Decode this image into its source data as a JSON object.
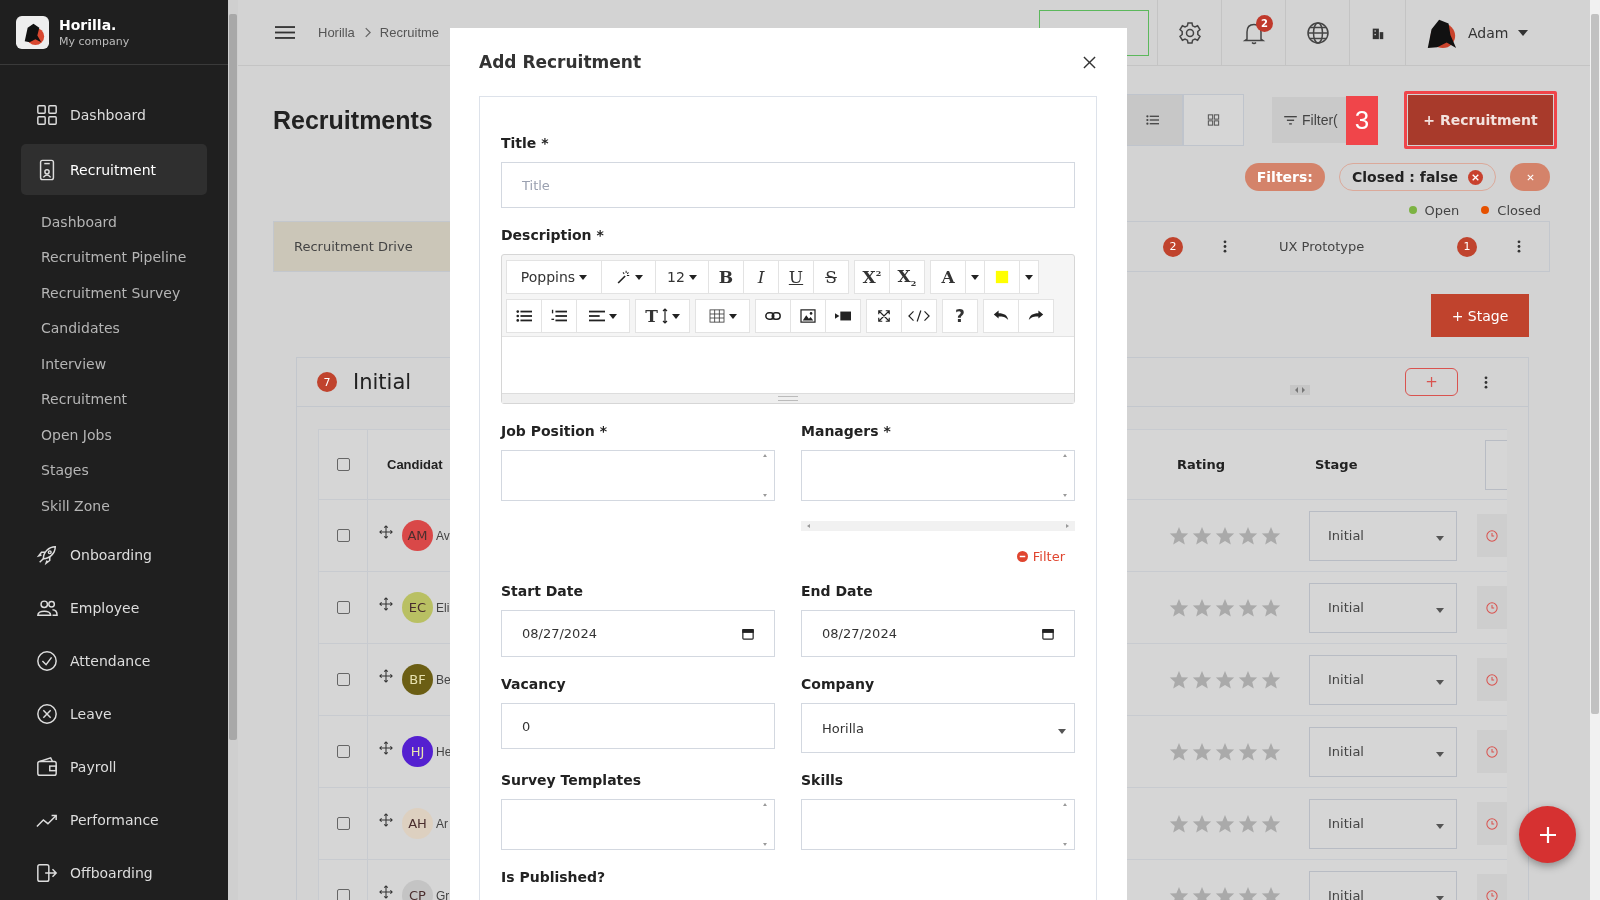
{
  "sidebar": {
    "brand": "Horilla.",
    "company": "My company",
    "items": [
      {
        "label": "Dashboard",
        "selected": false
      },
      {
        "label": "Recruitment",
        "selected": true,
        "children": [
          {
            "label": "Dashboard",
            "selected": false
          },
          {
            "label": "Recruitment Pipeline",
            "selected": false
          },
          {
            "label": "Recruitment Survey",
            "selected": false
          },
          {
            "label": "Candidates",
            "selected": false
          },
          {
            "label": "Interview",
            "selected": false
          },
          {
            "label": "Recruitment",
            "selected": false
          },
          {
            "label": "Open Jobs",
            "selected": false
          },
          {
            "label": "Stages",
            "selected": false
          },
          {
            "label": "Skill Zone",
            "selected": false
          }
        ]
      },
      {
        "label": "Onboarding",
        "selected": false
      },
      {
        "label": "Employee",
        "selected": false
      },
      {
        "label": "Attendance",
        "selected": false
      },
      {
        "label": "Leave",
        "selected": false
      },
      {
        "label": "Payroll",
        "selected": false
      },
      {
        "label": "Performance",
        "selected": false
      },
      {
        "label": "Offboarding",
        "selected": false
      }
    ]
  },
  "header": {
    "breadcrumb": [
      "Horilla",
      "Recruitme"
    ],
    "notifications": "2",
    "user": "Adam"
  },
  "page": {
    "title": "Recruitments",
    "views": [
      {
        "kind": "list",
        "selected": true
      },
      {
        "kind": "grid",
        "selected": false
      }
    ],
    "filter_button": "Filter(",
    "step_marker": "3",
    "add_button": "+ Recruitment",
    "filters_label": "Filters:",
    "filter_tags": [
      "Closed : false"
    ],
    "legend": [
      {
        "label": "Open",
        "color": "#7cb342"
      },
      {
        "label": "Closed",
        "color": "#e65100"
      }
    ]
  },
  "tabs": [
    {
      "label": "Recruitment Drive",
      "selected": true
    },
    {
      "count": "2",
      "selected": false
    },
    {
      "label": "UX Prototype",
      "count": "1",
      "selected": false
    }
  ],
  "stage_button": "+ Stage",
  "stage": {
    "count": "7",
    "name": "Initial",
    "add": "+",
    "table": {
      "select_all_checked": false,
      "columns": [
        "Candidat",
        "Rating",
        "Stage"
      ],
      "rows": [
        {
          "checked": false,
          "initials": "AM",
          "color": "#d94848",
          "name": "Av",
          "stars": 0,
          "stage": "Initial"
        },
        {
          "checked": false,
          "initials": "EC",
          "color": "#b9c063",
          "name": "Eli",
          "stars": 0,
          "stage": "Initial"
        },
        {
          "checked": false,
          "initials": "BF",
          "color": "#6b5e14",
          "name": "Be",
          "stars": 0,
          "stage": "Initial"
        },
        {
          "checked": false,
          "initials": "HJ",
          "color": "#5420d0",
          "name": "He",
          "stars": 0,
          "stage": "Initial"
        },
        {
          "checked": false,
          "initials": "AH",
          "color": "#ddd0c0",
          "name": "Ar",
          "stars": 0,
          "stage": "Initial"
        },
        {
          "checked": false,
          "initials": "CP",
          "color": "#c4c4c4",
          "name": "Gr",
          "stars": 0,
          "stage": "Initial"
        }
      ]
    }
  },
  "modal": {
    "title": "Add Recruitment",
    "toolbar": [
      [
        [
          {
            "kind": "font",
            "label": "Poppins"
          },
          {
            "kind": "magic"
          },
          {
            "kind": "size",
            "label": "12"
          },
          {
            "kind": "bold",
            "label": "B"
          },
          {
            "kind": "italic",
            "label": "I"
          },
          {
            "kind": "underline",
            "label": "U"
          },
          {
            "kind": "strike",
            "label": "S"
          }
        ],
        [
          {
            "kind": "sup",
            "label": "X$^{2}$"
          },
          {
            "kind": "sub",
            "label": "X$_{2}$"
          }
        ],
        [
          {
            "kind": "forecolor",
            "label": "A"
          },
          {
            "kind": "caret"
          },
          {
            "kind": "highlight"
          },
          {
            "kind": "caret"
          }
        ]
      ],
      [
        [
          {
            "kind": "ul"
          },
          {
            "kind": "ol"
          },
          {
            "kind": "align"
          }
        ],
        [
          {
            "kind": "height",
            "label": "T"
          }
        ],
        [
          {
            "kind": "table"
          }
        ],
        [
          {
            "kind": "link"
          },
          {
            "kind": "image"
          },
          {
            "kind": "video"
          }
        ],
        [
          {
            "kind": "fullscreen"
          },
          {
            "kind": "code"
          }
        ],
        [
          {
            "kind": "help",
            "label": "?"
          }
        ],
        [
          {
            "kind": "undo"
          },
          {
            "kind": "redo"
          }
        ]
      ]
    ],
    "fields": [
      {
        "kind": "text",
        "label": "Title *",
        "placeholder": "Title"
      },
      {
        "kind": "editor",
        "label": "Description *"
      },
      {
        "kind": "multiselect",
        "label": "Job Position *"
      },
      {
        "kind": "multiselect",
        "label": "Managers *",
        "filter_link": "Filter"
      },
      {
        "kind": "date",
        "label": "Start Date",
        "value": "08/27/2024"
      },
      {
        "kind": "date",
        "label": "End Date",
        "value": "08/27/2024"
      },
      {
        "kind": "number",
        "label": "Vacancy",
        "value": "0"
      },
      {
        "kind": "select",
        "label": "Company",
        "value": "Horilla"
      },
      {
        "kind": "multiselect",
        "label": "Survey Templates"
      },
      {
        "kind": "multiselect",
        "label": "Skills"
      },
      {
        "kind": "checkbox",
        "label": "Is Published?"
      }
    ]
  }
}
